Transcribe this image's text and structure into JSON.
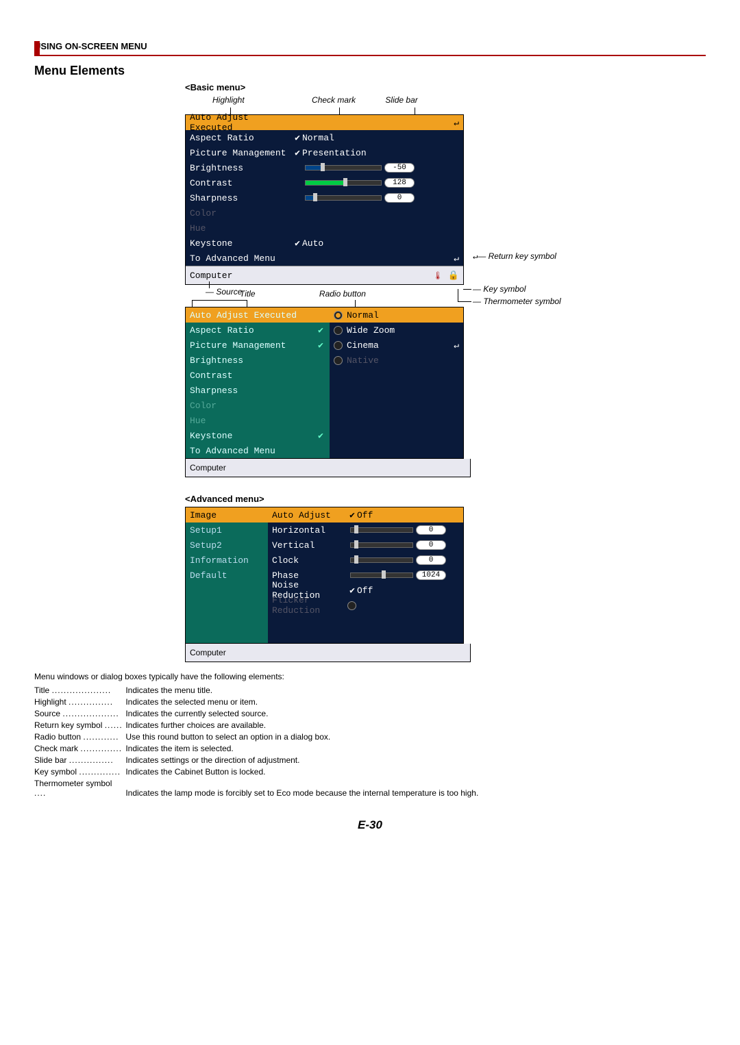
{
  "header": "USING ON-SCREEN MENU",
  "title": "Menu Elements",
  "basic_label": "<Basic menu>",
  "advanced_label": "<Advanced menu>",
  "annot": {
    "highlight": "Highlight",
    "checkmark": "Check mark",
    "slidebar": "Slide bar",
    "source": "Source",
    "title": "Title",
    "radio": "Radio button",
    "return": "Return key symbol",
    "key": "Key symbol",
    "thermo": "Thermometer symbol"
  },
  "basic1": {
    "rows": [
      {
        "label": "Auto Adjust Executed",
        "hl": true,
        "ret": true
      },
      {
        "label": "Aspect Ratio",
        "check": true,
        "val": "Normal"
      },
      {
        "label": "Picture Management",
        "check": true,
        "val": "Presentation"
      },
      {
        "label": "Brightness",
        "slider": {
          "fill": 20,
          "knob": 20
        },
        "num": "-50"
      },
      {
        "label": "Contrast",
        "slider": {
          "fill": 50,
          "knob": 50,
          "green": true
        },
        "num": "128"
      },
      {
        "label": "Sharpness",
        "slider": {
          "fill": 10,
          "knob": 10
        },
        "num": "0"
      },
      {
        "label": "Color",
        "disabled": true
      },
      {
        "label": "Hue",
        "disabled": true
      },
      {
        "label": "Keystone",
        "check": true,
        "val": "Auto"
      },
      {
        "label": "To Advanced Menu",
        "ret": true
      }
    ],
    "status": "Computer"
  },
  "basic2": {
    "left": [
      {
        "label": "Auto Adjust Executed",
        "hl": true
      },
      {
        "label": "Aspect Ratio",
        "chk": true
      },
      {
        "label": "Picture Management",
        "chk": true
      },
      {
        "label": "Brightness"
      },
      {
        "label": "Contrast"
      },
      {
        "label": "Sharpness"
      },
      {
        "label": "Color",
        "disabled": true
      },
      {
        "label": "Hue",
        "disabled": true
      },
      {
        "label": "Keystone",
        "chk": true
      },
      {
        "label": "To Advanced Menu"
      }
    ],
    "right": [
      {
        "label": "Normal",
        "sel": true,
        "hl": true
      },
      {
        "label": "Wide Zoom"
      },
      {
        "label": "Cinema",
        "ret": true
      },
      {
        "label": "Native",
        "disabled": true
      }
    ],
    "status": "Computer"
  },
  "advanced": {
    "left": [
      {
        "label": "Image",
        "hl": true
      },
      {
        "label": "Setup1"
      },
      {
        "label": "Setup2"
      },
      {
        "label": "Information"
      },
      {
        "label": "Default"
      }
    ],
    "right": [
      {
        "label": "Auto Adjust",
        "check": true,
        "val": "Off",
        "hl": true
      },
      {
        "label": "Horizontal",
        "slider": {
          "knob": 5
        },
        "num": "0"
      },
      {
        "label": "Vertical",
        "slider": {
          "knob": 5
        },
        "num": "0"
      },
      {
        "label": "Clock",
        "slider": {
          "knob": 5
        },
        "num": "0"
      },
      {
        "label": "Phase",
        "slider": {
          "knob": 50
        },
        "num": "1024"
      },
      {
        "label": "Noise Reduction",
        "check": true,
        "val": "Off"
      },
      {
        "label": "Flicker Reduction",
        "radio": true,
        "disabled": true
      }
    ],
    "status": "Computer"
  },
  "desc_intro": "Menu windows or dialog boxes typically have the following elements:",
  "glossary": [
    {
      "term": "Title",
      "def": "Indicates the menu title."
    },
    {
      "term": "Highlight",
      "def": "Indicates the selected menu or item."
    },
    {
      "term": "Source",
      "def": "Indicates the currently selected source."
    },
    {
      "term": "Return key symbol",
      "def": "Indicates further choices are available."
    },
    {
      "term": "Radio button",
      "def": "Use this round button to select an option in a dialog box."
    },
    {
      "term": "Check mark",
      "def": "Indicates the item is selected."
    },
    {
      "term": "Slide bar",
      "def": "Indicates settings or the direction of adjustment."
    },
    {
      "term": "Key symbol",
      "def": "Indicates the Cabinet Button is locked."
    },
    {
      "term": "Thermometer symbol",
      "def": "Indicates the lamp mode is forcibly set to Eco mode because the internal temperature is too high."
    }
  ],
  "pagenum": "E-30"
}
